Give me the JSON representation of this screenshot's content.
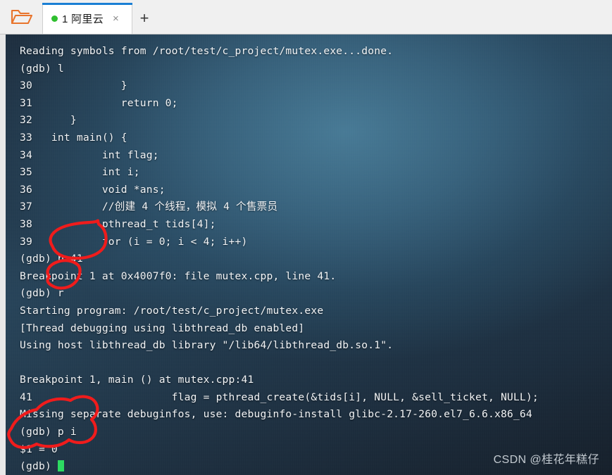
{
  "window": {
    "folder_icon": "open-folder-icon",
    "new_tab_label": "+",
    "accent_color": "#1a7fd4",
    "terminal_bg": "#2d6080"
  },
  "tabs": [
    {
      "title": "1 阿里云",
      "status_dot": "connected-dot",
      "status_color": "#2fbf2f",
      "close_label": "×",
      "active": true
    }
  ],
  "terminal": {
    "cursor": "block-cursor",
    "cursor_color": "#2ddb62",
    "lines": [
      "Reading symbols from /root/test/c_project/mutex.exe...done.",
      "(gdb) l",
      "30              }",
      "31              return 0;",
      "32      }",
      "33   int main() {",
      "34           int flag;",
      "35           int i;",
      "36           void *ans;",
      "37           //创建 4 个线程，模拟 4 个售票员",
      "38           pthread_t tids[4];",
      "39           for (i = 0; i < 4; i++)",
      "(gdb) b 41",
      "Breakpoint 1 at 0x4007f0: file mutex.cpp, line 41.",
      "(gdb) r",
      "Starting program: /root/test/c_project/mutex.exe",
      "[Thread debugging using libthread_db enabled]",
      "Using host libthread_db library \"/lib64/libthread_db.so.1\".",
      "",
      "Breakpoint 1, main () at mutex.cpp:41",
      "41                      flag = pthread_create(&tids[i], NULL, &sell_ticket, NULL);",
      "Missing separate debuginfos, use: debuginfo-install glibc-2.17-260.el7_6.6.x86_64",
      "(gdb) p i",
      "$1 = 0",
      "(gdb) "
    ],
    "prompt": "(gdb)"
  },
  "annotations": {
    "color": "#f01c1c",
    "marks": [
      {
        "name": "circle-around-b41",
        "target": "b 41"
      },
      {
        "name": "circle-around-r",
        "target": "r"
      },
      {
        "name": "circle-around-print-i",
        "target": "p i / $1 = 0"
      }
    ]
  },
  "watermark": {
    "text": "CSDN @桂花年糕仔"
  }
}
